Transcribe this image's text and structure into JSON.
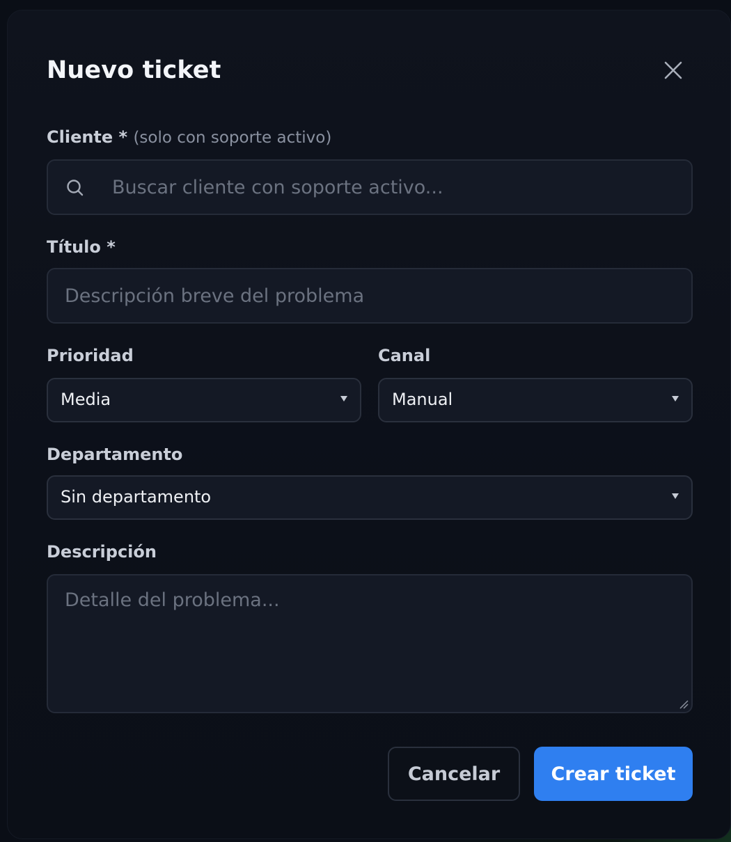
{
  "modal": {
    "title": "Nuevo ticket"
  },
  "cliente": {
    "label": "Cliente *",
    "hint": "(solo con soporte activo)",
    "placeholder": "Buscar cliente con soporte activo...",
    "value": ""
  },
  "titulo": {
    "label": "Título *",
    "placeholder": "Descripción breve del problema",
    "value": ""
  },
  "prioridad": {
    "label": "Prioridad",
    "selected": "Media"
  },
  "canal": {
    "label": "Canal",
    "selected": "Manual"
  },
  "departamento": {
    "label": "Departamento",
    "selected": "Sin departamento"
  },
  "descripcion": {
    "label": "Descripción",
    "placeholder": "Detalle del problema...",
    "value": ""
  },
  "actions": {
    "cancel_label": "Cancelar",
    "create_label": "Crear ticket"
  },
  "icons": {
    "close": "close-icon",
    "search": "search-icon",
    "chevron": "chevron-down-icon"
  },
  "colors": {
    "accent": "#2f7ff0",
    "modal_bg": "#0f131d",
    "field_bg": "#141925"
  }
}
